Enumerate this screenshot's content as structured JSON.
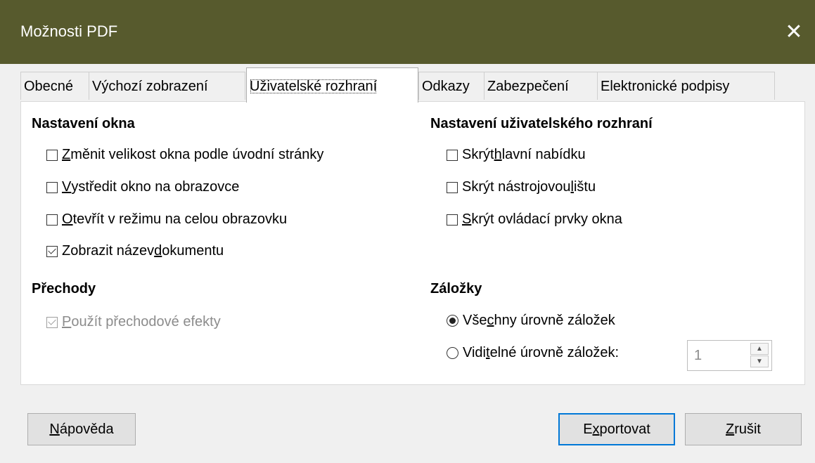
{
  "window": {
    "title": "Možnosti PDF",
    "close_icon": "close-icon"
  },
  "tabs": [
    {
      "label": "Obecné"
    },
    {
      "label": "Výchozí zobrazení"
    },
    {
      "label": "Uživatelské rozhraní"
    },
    {
      "label": "Odkazy"
    },
    {
      "label": "Zabezpečení"
    },
    {
      "label": "Elektronické podpisy"
    }
  ],
  "active_tab": "Uživatelské rozhraní",
  "window_settings": {
    "title": "Nastavení okna",
    "options": [
      {
        "pre": "",
        "u": "Z",
        "post": "měnit velikost okna podle úvodní stránky",
        "checked": false
      },
      {
        "pre": "",
        "u": "V",
        "post": "ystředit okno na obrazovce",
        "checked": false
      },
      {
        "pre": "",
        "u": "O",
        "post": "tevřít v režimu na celou obrazovku",
        "checked": false
      },
      {
        "pre": "Zobrazit název ",
        "u": "d",
        "post": "okumentu",
        "checked": true
      }
    ]
  },
  "ui_settings": {
    "title": "Nastavení uživatelského rozhraní",
    "options": [
      {
        "pre": "Skrýt ",
        "u": "h",
        "post": "lavní nabídku",
        "checked": false
      },
      {
        "pre": "Skrýt nástrojovou ",
        "u": "l",
        "post": "ištu",
        "checked": false
      },
      {
        "pre": "",
        "u": "S",
        "post": "krýt ovládací prvky okna",
        "checked": false
      }
    ]
  },
  "transitions": {
    "title": "Přechody",
    "option": {
      "pre": "",
      "u": "P",
      "post": "oužít přechodové efekty",
      "checked": true,
      "disabled": true
    }
  },
  "bookmarks": {
    "title": "Záložky",
    "all": {
      "pre": "Vše",
      "u": "c",
      "post": "hny úrovně záložek",
      "selected": true
    },
    "visible": {
      "pre": "Vidi",
      "u": "t",
      "post": "elné úrovně záložek:",
      "selected": false
    },
    "level_value": "1"
  },
  "buttons": {
    "help": {
      "pre": "",
      "u": "N",
      "post": "ápověda"
    },
    "export": {
      "pre": "E",
      "u": "x",
      "post": "portovat"
    },
    "cancel": {
      "pre": "",
      "u": "Z",
      "post": "rušit"
    }
  },
  "colors": {
    "titlebar": "#575a2d",
    "focus": "#0078d7"
  }
}
